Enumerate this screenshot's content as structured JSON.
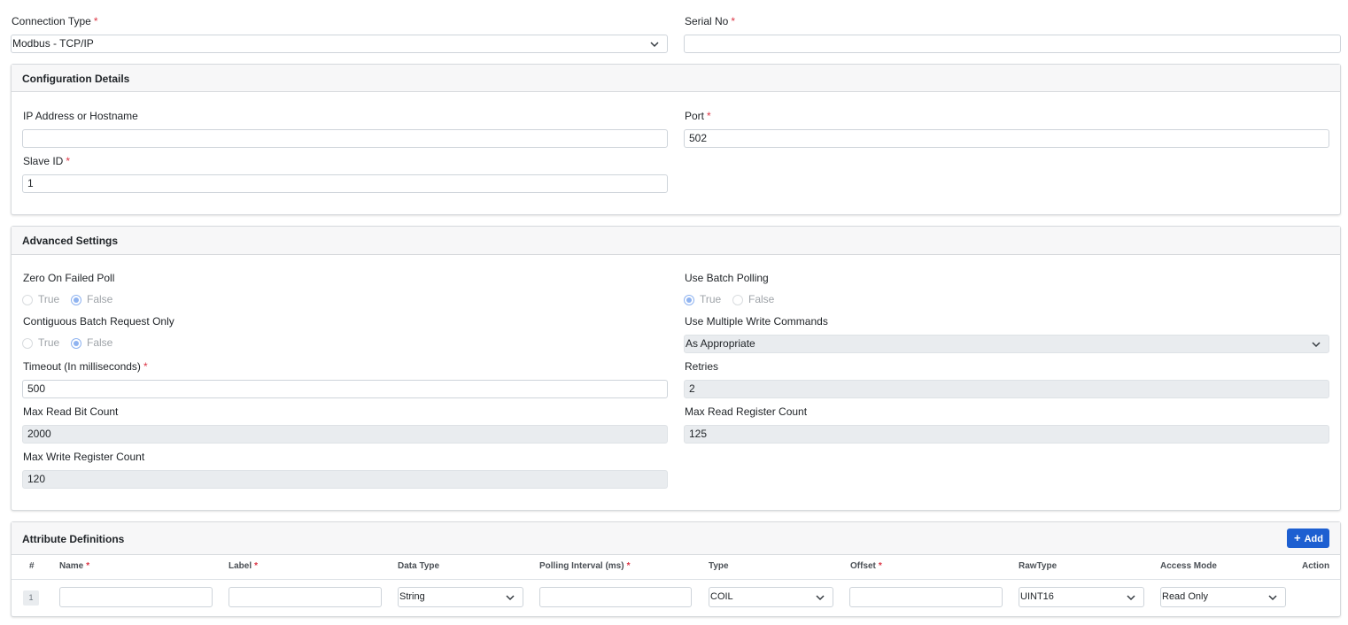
{
  "top": {
    "connection_type_label": "Connection Type",
    "connection_type_value": "Modbus - TCP/IP",
    "serial_no_label": "Serial No",
    "serial_no_value": ""
  },
  "config": {
    "title": "Configuration Details",
    "ip_label": "IP Address or Hostname",
    "ip_value": "",
    "port_label": "Port",
    "port_value": "502",
    "slave_label": "Slave ID",
    "slave_value": "1"
  },
  "advanced": {
    "title": "Advanced Settings",
    "zero_label": "Zero On Failed Poll",
    "zero_selected": "False",
    "batch_label": "Use Batch Polling",
    "batch_selected": "True",
    "contig_label": "Contiguous Batch Request Only",
    "contig_selected": "False",
    "multi_write_label": "Use Multiple Write Commands",
    "multi_write_value": "As Appropriate",
    "timeout_label": "Timeout (In milliseconds)",
    "timeout_value": "500",
    "retries_label": "Retries",
    "retries_value": "2",
    "max_read_bit_label": "Max Read Bit Count",
    "max_read_bit_value": "2000",
    "max_read_reg_label": "Max Read Register Count",
    "max_read_reg_value": "125",
    "max_write_reg_label": "Max Write Register Count",
    "max_write_reg_value": "120",
    "opt_true": "True",
    "opt_false": "False"
  },
  "attributes": {
    "title": "Attribute Definitions",
    "add_label": "Add",
    "columns": [
      "#",
      "Name",
      "Label",
      "Data Type",
      "Polling Interval (ms)",
      "Type",
      "Offset",
      "RawType",
      "Access Mode",
      "Action"
    ],
    "rows": [
      {
        "index": "1",
        "name": "",
        "label": "",
        "data_type": "String",
        "polling_interval": "",
        "type": "COIL",
        "offset": "",
        "raw_type": "UINT16",
        "access_mode": "Read Only"
      }
    ]
  },
  "required_mark": "*",
  "colors": {
    "accent": "#1d5fd1",
    "required": "#dc3545",
    "radio_selected": "#8fb3f0"
  }
}
